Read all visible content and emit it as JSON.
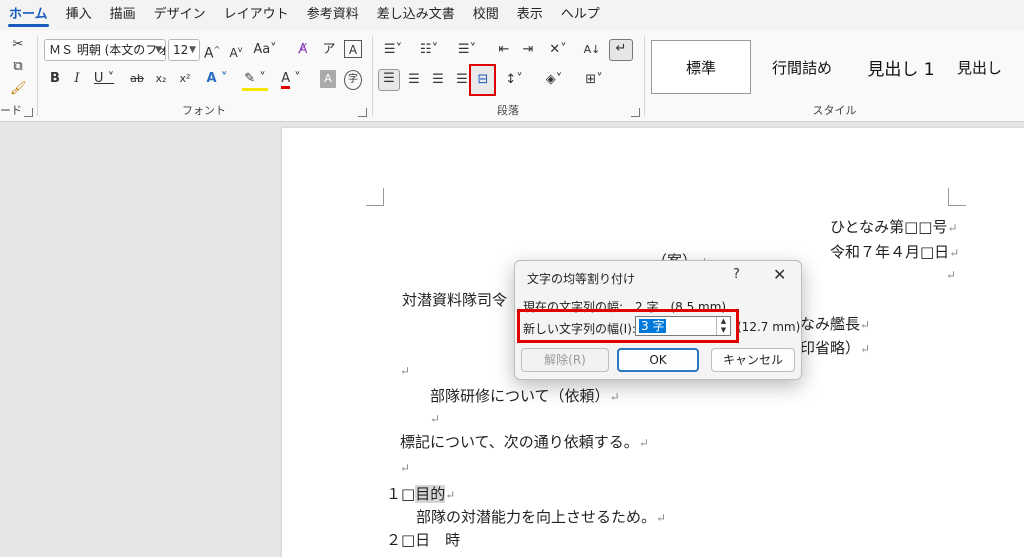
{
  "tabs": [
    "ホーム",
    "挿入",
    "描画",
    "デザイン",
    "レイアウト",
    "参考資料",
    "差し込み文書",
    "校閲",
    "表示",
    "ヘルプ"
  ],
  "ribbon": {
    "clipboard_label_fragment": "ード",
    "font_group_label": "フォント",
    "paragraph_group_label": "段落",
    "styles_group_label": "スタイル",
    "font_name": "ＭＳ 明朝 (本文のフォ",
    "font_size": "12",
    "case_button": "Aa",
    "styles": [
      "標準",
      "行間詰め",
      "見出し 1",
      "見出し"
    ]
  },
  "document": {
    "header_right_1": "ひとなみ第□□号",
    "header_right_2": "令和７年４月□日",
    "draft_mark": "（案）",
    "addressee": "対潜資料隊司令",
    "sender": "なみ艦長",
    "seal_note": "印省略）",
    "subject": "部隊研修について（依頼）",
    "body": "標記について、次の通り依頼する。",
    "item1_num": "１□",
    "item1_title": "目的",
    "item1_text": "部隊の対潜能力を向上させるため。",
    "item2": "２□日　時"
  },
  "dialog": {
    "title": "文字の均等割り付け",
    "help": "?",
    "close": "✕",
    "current_label": "現在の文字列の幅:",
    "current_value": "2 字　(8.5 mm)",
    "new_label": "新しい文字列の幅(I):",
    "new_value": "3 字",
    "new_mm": "(12.7 mm)",
    "clear_button": "解除(R)",
    "ok_button": "OK",
    "cancel_button": "キャンセル"
  },
  "colors": {
    "accent": "#185abd",
    "highlight_red": "#e00000"
  }
}
